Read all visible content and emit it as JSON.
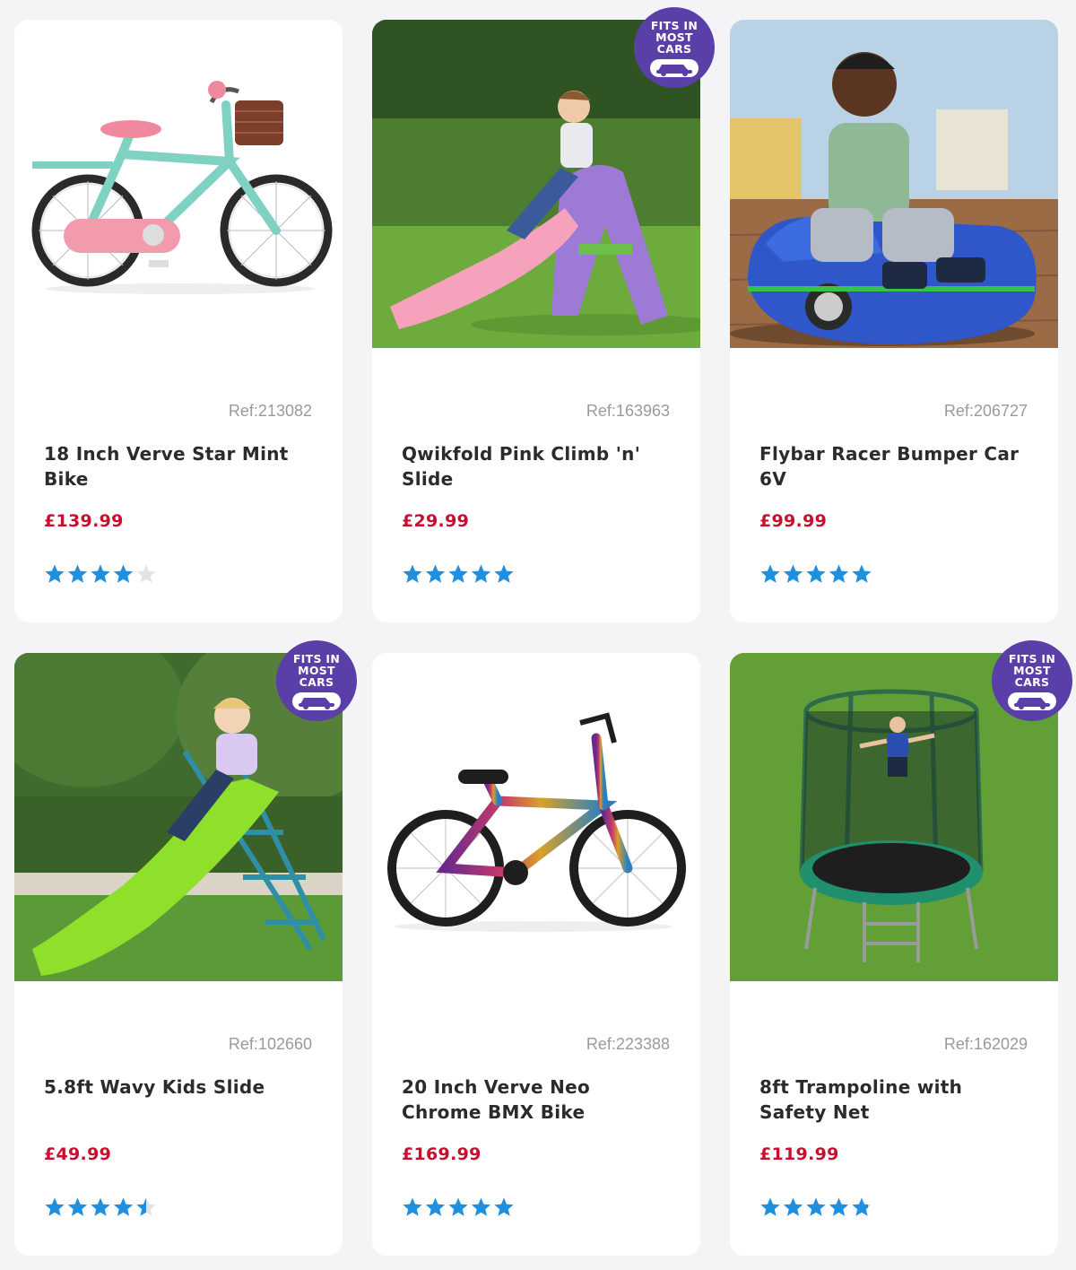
{
  "badge": {
    "line1": "FITS IN",
    "line2": "MOST",
    "line3": "CARS",
    "icon": "car-icon"
  },
  "colors": {
    "badge": "#5b3fa8",
    "price": "#c8102e",
    "star": "#1f8fe0",
    "star_empty": "#e3e3e3"
  },
  "products": [
    {
      "ref": "Ref:213082",
      "title": "18 Inch Verve Star Mint Bike",
      "price": "£139.99",
      "rating": 4.0,
      "fits_in_most_cars": false,
      "image": "mint-bike-image"
    },
    {
      "ref": "Ref:163963",
      "title": "Qwikfold Pink Climb 'n' Slide",
      "price": "£29.99",
      "rating": 5.0,
      "fits_in_most_cars": true,
      "image": "pink-slide-image"
    },
    {
      "ref": "Ref:206727",
      "title": "Flybar Racer Bumper Car 6V",
      "price": "£99.99",
      "rating": 5.0,
      "fits_in_most_cars": false,
      "image": "bumper-car-image"
    },
    {
      "ref": "Ref:102660",
      "title": "5.8ft Wavy Kids Slide",
      "price": "£49.99",
      "rating": 4.5,
      "fits_in_most_cars": true,
      "image": "green-slide-image"
    },
    {
      "ref": "Ref:223388",
      "title": "20 Inch Verve Neo Chrome BMX Bike",
      "price": "£169.99",
      "rating": 5.0,
      "fits_in_most_cars": false,
      "image": "bmx-bike-image"
    },
    {
      "ref": "Ref:162029",
      "title": "8ft Trampoline with Safety Net",
      "price": "£119.99",
      "rating": 4.8,
      "fits_in_most_cars": true,
      "image": "trampoline-image"
    }
  ]
}
